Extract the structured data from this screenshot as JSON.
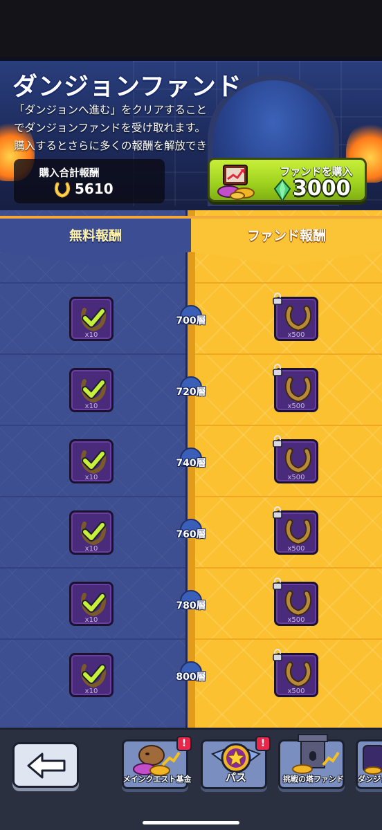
{
  "header": {
    "title": "ダンジョンファンド",
    "description_lines": [
      "「ダンジョンへ進む」をクリアすること",
      "でダンジョンファンドを受け取れます。",
      "購入するとさらに多くの報酬を解放でき"
    ],
    "total_reward_label": "購入合計報酬",
    "total_reward_value": "5610",
    "total_reward_icon": "horseshoe-icon",
    "buy_button": {
      "label": "ファンドを購入",
      "price": "3000",
      "currency_icon": "green-gem-icon",
      "icon": "treasure-chest-icon"
    }
  },
  "tabs": {
    "free": "無料報酬",
    "fund": "ファンド報酬"
  },
  "rows": [
    {
      "floor": "700層",
      "free_qty": "x10",
      "fund_qty": "x500",
      "free_status": "claimed",
      "fund_status": "locked"
    },
    {
      "floor": "720層",
      "free_qty": "x10",
      "fund_qty": "x500",
      "free_status": "claimed",
      "fund_status": "locked"
    },
    {
      "floor": "740層",
      "free_qty": "x10",
      "fund_qty": "x500",
      "free_status": "claimed",
      "fund_status": "locked"
    },
    {
      "floor": "760層",
      "free_qty": "x10",
      "fund_qty": "x500",
      "free_status": "claimed",
      "fund_status": "locked"
    },
    {
      "floor": "780層",
      "free_qty": "x10",
      "fund_qty": "x500",
      "free_status": "claimed",
      "fund_status": "locked"
    },
    {
      "floor": "800層",
      "free_qty": "x10",
      "fund_qty": "x500",
      "free_status": "claimed",
      "fund_status": "locked"
    }
  ],
  "bottom_nav": {
    "back_icon": "back-arrow-icon",
    "items": [
      {
        "label": "メインクエスト基金",
        "icon": "capybara-coins-icon",
        "badge": "!"
      },
      {
        "label": "パス",
        "icon": "star-shield-icon",
        "badge": "!"
      },
      {
        "label": "挑戦の塔ファンド",
        "icon": "tower-coins-icon",
        "badge": ""
      },
      {
        "label": "ダンジョ",
        "icon": "dungeon-fund-icon",
        "badge": ""
      }
    ]
  },
  "colors": {
    "free_column": "#3e4f91",
    "fund_column": "#fbc130",
    "buy_button": "#9ed11e",
    "tile": "#4a2a7a",
    "badge": "#e8284a"
  }
}
